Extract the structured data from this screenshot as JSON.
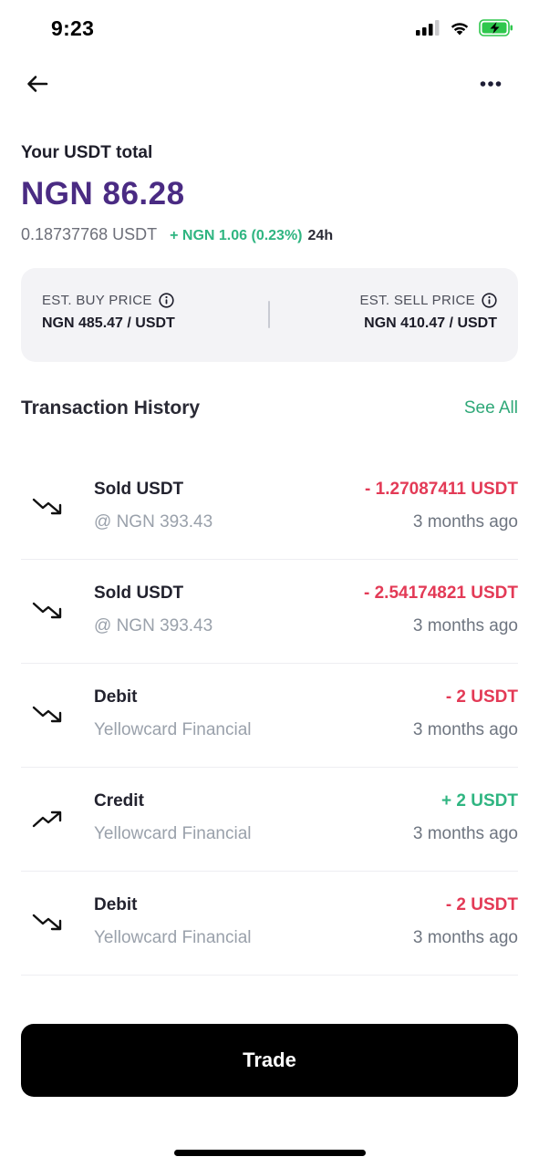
{
  "status_bar": {
    "time": "9:23",
    "icons": [
      "cellular-signal-icon",
      "wifi-icon",
      "battery-charging-icon"
    ]
  },
  "nav": {
    "back_icon": "arrow-left-icon",
    "more_icon": "more-horizontal-icon"
  },
  "balance": {
    "label": "Your USDT total",
    "value": "NGN 86.28",
    "usdt": "0.18737768 USDT",
    "change": "+ NGN 1.06 (0.23%)",
    "period": "24h"
  },
  "prices": {
    "buy_label": "EST. BUY PRICE",
    "buy_value": "NGN 485.47 / USDT",
    "sell_label": "EST. SELL PRICE",
    "sell_value": "NGN 410.47 / USDT"
  },
  "transactions": {
    "title": "Transaction History",
    "see_all": "See All",
    "items": [
      {
        "icon": "trend-down-icon",
        "name": "Sold USDT",
        "sub": "@ NGN 393.43",
        "amount": "- 1.27087411 USDT",
        "direction": "negative",
        "time": "3 months ago"
      },
      {
        "icon": "trend-down-icon",
        "name": "Sold USDT",
        "sub": "@ NGN 393.43",
        "amount": "- 2.54174821 USDT",
        "direction": "negative",
        "time": "3 months ago"
      },
      {
        "icon": "trend-down-icon",
        "name": "Debit",
        "sub": "Yellowcard Financial",
        "amount": "- 2 USDT",
        "direction": "negative",
        "time": "3 months ago"
      },
      {
        "icon": "trend-up-icon",
        "name": "Credit",
        "sub": "Yellowcard Financial",
        "amount": "+ 2 USDT",
        "direction": "positive",
        "time": "3 months ago"
      },
      {
        "icon": "trend-down-icon",
        "name": "Debit",
        "sub": "Yellowcard Financial",
        "amount": "- 2 USDT",
        "direction": "negative",
        "time": "3 months ago"
      }
    ]
  },
  "trade_button": "Trade",
  "colors": {
    "brand_purple": "#4a2b83",
    "positive_green": "#2fb581",
    "negative_red": "#e33a56",
    "card_bg": "#f3f3f6"
  }
}
